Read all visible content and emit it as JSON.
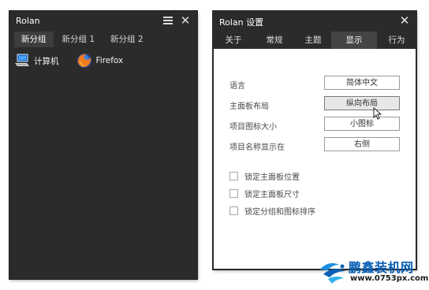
{
  "rolan_window": {
    "title": "Rolan",
    "menu_icon": "hamburger-icon",
    "close_icon": "close-icon",
    "groups": [
      "新分组",
      "新分组 1",
      "新分组 2"
    ],
    "active_group": 0,
    "items": [
      {
        "label": "计算机",
        "icon": "computer-icon"
      },
      {
        "label": "Firefox",
        "icon": "firefox-icon"
      }
    ]
  },
  "settings_window": {
    "title": "Rolan 设置",
    "close_icon": "close-icon",
    "tabs": [
      "关于",
      "常规",
      "主题",
      "显示",
      "行为"
    ],
    "active_tab": 3,
    "rows": [
      {
        "label": "语言",
        "value": "简体中文"
      },
      {
        "label": "主面板布局",
        "value": "纵向布局"
      },
      {
        "label": "项目图标大小",
        "value": "小图标"
      },
      {
        "label": "项目名称显示在",
        "value": "右侧"
      }
    ],
    "checkboxes": [
      {
        "label": "锁定主面板位置",
        "checked": false
      },
      {
        "label": "锁定主面板尺寸",
        "checked": false
      },
      {
        "label": "锁定分组和图标排序",
        "checked": false
      }
    ]
  },
  "watermark": {
    "brand": "鹏鑫装机网",
    "url": "www.0753px.com"
  },
  "colors": {
    "dark_bg": "#2b2b2b",
    "active_tab": "#444444",
    "brand_blue": "#0a5fb4"
  }
}
